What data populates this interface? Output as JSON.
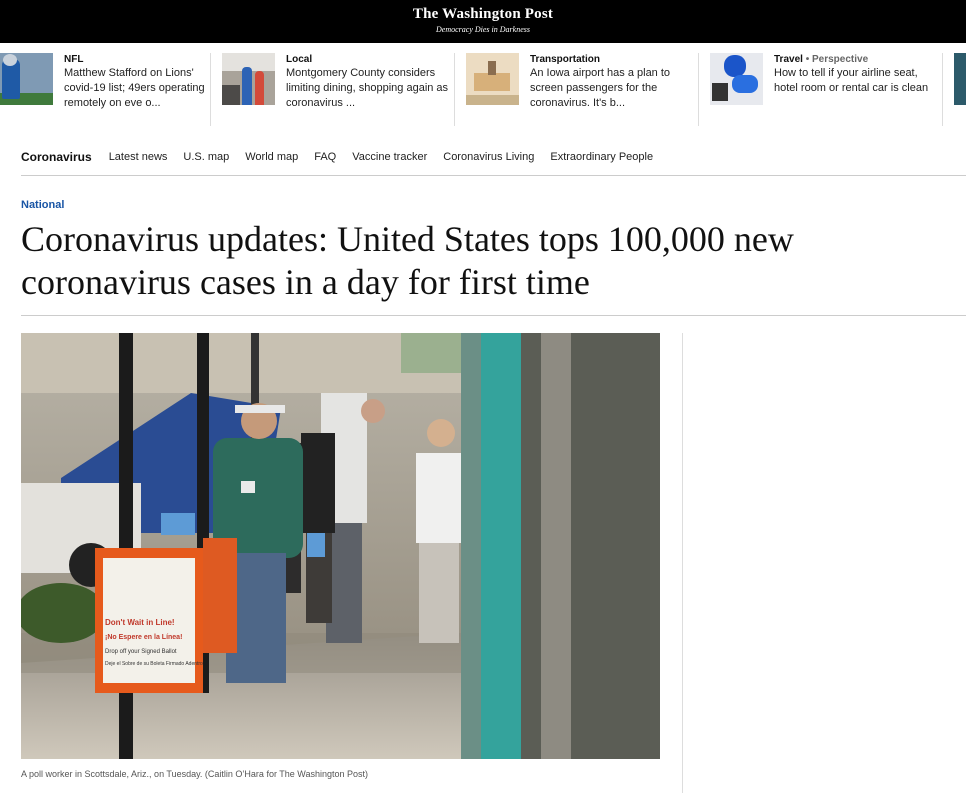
{
  "masthead": {
    "logo": "The Washington Post",
    "tagline": "Democracy Dies in Darkness"
  },
  "rail": [
    {
      "kicker": "NFL",
      "perspective": "",
      "headline": "Matthew Stafford on Lions' covid-19 list; 49ers operating remotely on eve o..."
    },
    {
      "kicker": "Local",
      "perspective": "",
      "headline": "Montgomery County considers limiting dining, shopping again as coronavirus ..."
    },
    {
      "kicker": "Transportation",
      "perspective": "",
      "headline": "An Iowa airport has a plan to screen passengers for the coronavirus. It's b..."
    },
    {
      "kicker": "Travel",
      "perspective": "• Perspective",
      "headline": "How to tell if your airline seat, hotel room or rental car is clean"
    }
  ],
  "section_nav": {
    "title": "Coronavirus",
    "links": [
      "Latest news",
      "U.S. map",
      "World map",
      "FAQ",
      "Vaccine tracker",
      "Coronavirus Living",
      "Extraordinary People"
    ]
  },
  "article": {
    "kicker": "National",
    "headline": "Coronavirus updates: United States tops 100,000 new coronavirus cases in a day for first time",
    "caption": "A poll worker in Scottsdale, Ariz., on Tuesday. (Caitlin O’Hara for The Washington Post)",
    "sign_text": [
      "Don't Wait in Line!",
      "¡No Espere en la Línea!",
      "Drop off your Signed Ballot",
      "Deje el Sobre de su Boleta Firmado Adentro"
    ]
  },
  "colors": {
    "masthead_bg": "#000000",
    "kicker_blue": "#1955a5",
    "rule": "#cccccc"
  }
}
